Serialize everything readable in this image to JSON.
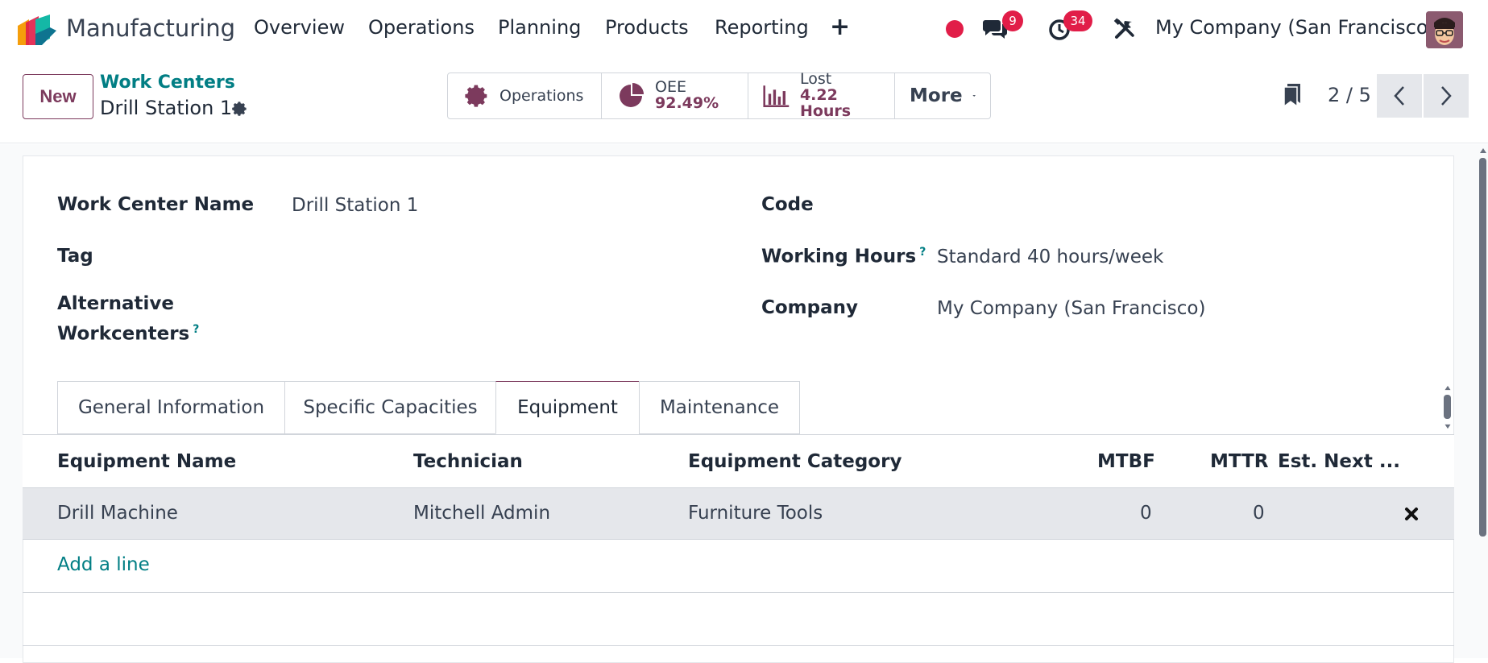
{
  "navbar": {
    "app_name": "Manufacturing",
    "menu": [
      "Overview",
      "Operations",
      "Planning",
      "Products",
      "Reporting"
    ],
    "plus_icon": "+",
    "messages_badge": "9",
    "activities_badge": "34",
    "company": "My Company (San Francisco)"
  },
  "control": {
    "new_label": "New",
    "breadcrumb_parent": "Work Centers",
    "breadcrumb_current": "Drill Station 1",
    "stats": {
      "operations_label": "Operations",
      "oee_label": "OEE",
      "oee_value": "92.49%",
      "lost_label": "Lost",
      "lost_value": "4.22 Hours",
      "more_label": "More"
    },
    "pager": "2 / 5"
  },
  "form": {
    "name_label": "Work Center Name",
    "name_value": "Drill Station 1",
    "tag_label": "Tag",
    "alt_label_1": "Alternative",
    "alt_label_2": "Workcenters",
    "code_label": "Code",
    "hours_label": "Working Hours",
    "hours_value": "Standard 40 hours/week",
    "company_label": "Company",
    "company_value": "My Company (San Francisco)",
    "help_mark": "?"
  },
  "tabs": [
    "General Information",
    "Specific Capacities",
    "Equipment",
    "Maintenance"
  ],
  "table": {
    "headers": [
      "Equipment Name",
      "Technician",
      "Equipment Category",
      "MTBF",
      "MTTR",
      "Est. Next ..."
    ],
    "rows": [
      {
        "name": "Drill Machine",
        "technician": "Mitchell Admin",
        "category": "Furniture Tools",
        "mtbf": "0",
        "mttr": "0"
      }
    ],
    "add_line": "Add a line"
  },
  "colors": {
    "brand": "#7c3a5d",
    "accent": "#017e84",
    "badge": "#e11d48"
  }
}
